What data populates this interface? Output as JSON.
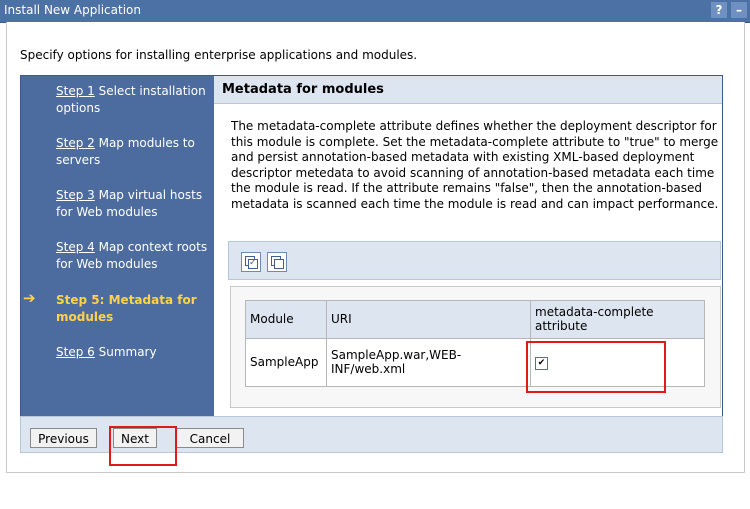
{
  "window": {
    "title": "Install New Application",
    "help_label": "?",
    "minimize_label": "–"
  },
  "intro": "Specify options for installing enterprise applications and modules.",
  "steps": [
    {
      "link": "Step 1",
      "text": " Select installation options"
    },
    {
      "link": "Step 2",
      "text": " Map modules to servers"
    },
    {
      "link": "Step 3",
      "text": " Map virtual hosts for Web modules"
    },
    {
      "link": "Step 4",
      "text": " Map context roots for Web modules"
    },
    {
      "text": "Step 5: Metadata for modules",
      "current": true
    },
    {
      "link": "Step 6",
      "text": " Summary"
    }
  ],
  "current_arrow": "➔",
  "content": {
    "heading": "Metadata for modules",
    "description": "The metadata-complete attribute defines whether the deployment descriptor for this module is complete. Set the metadata-complete attribute to \"true\" to merge and persist annotation-based metadata with existing XML-based deployment descriptor metedata to avoid scanning of annotation-based metadata each time the module is read. If the attribute remains \"false\", then the annotation-based metadata is scanned each time the module is read and can impact performance."
  },
  "table": {
    "headers": {
      "module": "Module",
      "uri": "URI",
      "metadata": "metadata-complete attribute"
    },
    "rows": [
      {
        "module": "SampleApp",
        "uri": "SampleApp.war,WEB-INF/web.xml",
        "checked": true
      }
    ]
  },
  "checkmark": "✔",
  "buttons": {
    "previous": "Previous",
    "next": "Next",
    "cancel": "Cancel"
  },
  "colors": {
    "titlebar": "#4c71a5",
    "nav_bg": "#4c6ca0",
    "current_step": "#ffd24a",
    "panel_header": "#dde5f0",
    "highlight": "#e01919"
  }
}
